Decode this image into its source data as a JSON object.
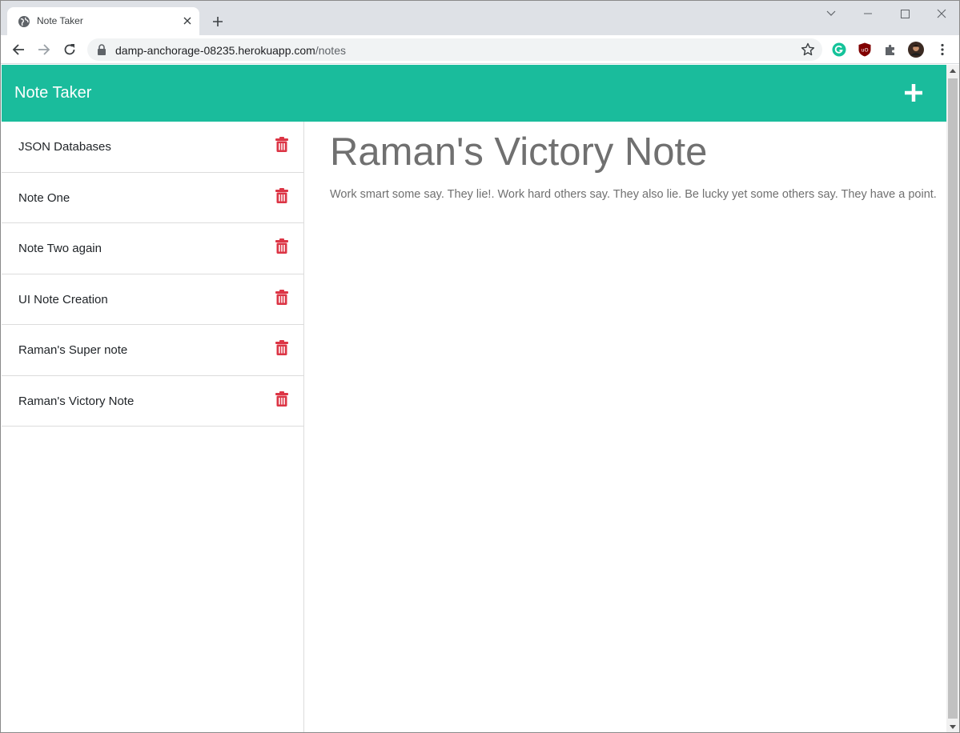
{
  "browser": {
    "tab_title": "Note Taker",
    "tab_icon": "globe-icon",
    "url_host": "damp-anchorage-08235.herokuapp.com",
    "url_path": "/notes"
  },
  "app": {
    "brand": "Note Taker",
    "accent_color": "#1abc9c",
    "delete_color": "#dc3545",
    "new_note_icon": "plus-icon",
    "notes": [
      {
        "title": "JSON Databases"
      },
      {
        "title": "Note One"
      },
      {
        "title": "Note Two again"
      },
      {
        "title": "UI Note Creation"
      },
      {
        "title": "Raman's Super note"
      },
      {
        "title": "Raman's Victory Note"
      }
    ],
    "active_note": {
      "title": "Raman's Victory Note",
      "text": "Work smart some say. They lie!. Work hard others say. They also lie. Be lucky yet some others say. They have a point."
    }
  }
}
